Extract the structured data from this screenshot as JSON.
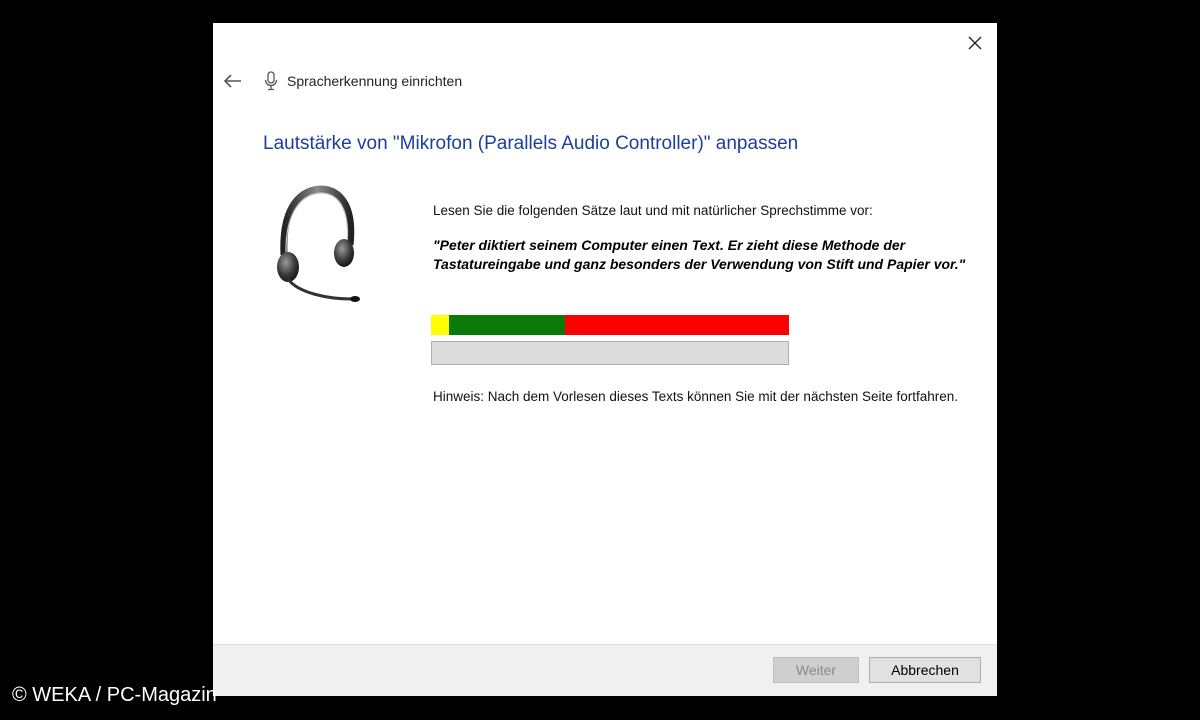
{
  "window": {
    "title": "Spracherkennung einrichten",
    "close_icon": "close-icon",
    "back_icon": "back-arrow-icon",
    "app_icon": "microphone-icon"
  },
  "page": {
    "heading": "Lautstärke von \"Mikrofon (Parallels Audio Controller)\" anpassen",
    "illustration": "headset-icon",
    "instruction": "Lesen Sie die folgenden Sätze laut und mit natürlicher Sprechstimme vor:",
    "sentence": "\"Peter diktiert seinem Computer einen Text. Er zieht diese Methode der Tastatureingabe und ganz besonders der Verwendung von Stift und Papier vor.\"",
    "meter_colors": {
      "low": "#ffff00",
      "good": "#0a7a0a",
      "high": "#ff0000"
    },
    "level": 0,
    "hint": "Hinweis: Nach dem Vorlesen dieses Texts können Sie mit der nächsten Seite fortfahren."
  },
  "footer": {
    "next_label": "Weiter",
    "next_enabled": false,
    "cancel_label": "Abbrechen"
  },
  "watermark": "© WEKA / PC-Magazin",
  "colors": {
    "heading": "#1c3f9c",
    "background": "#000000",
    "dialog": "#ffffff"
  }
}
